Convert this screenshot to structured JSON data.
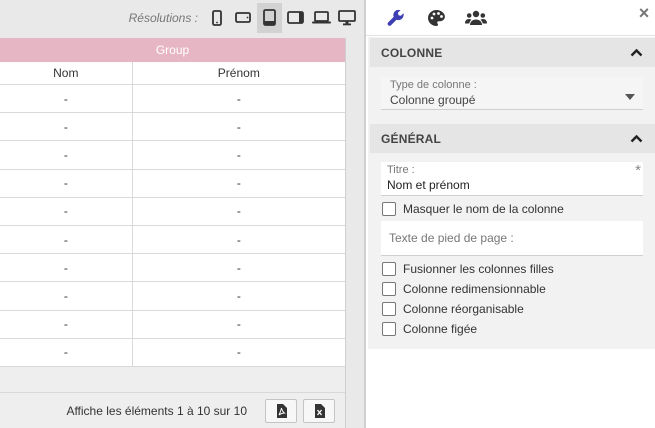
{
  "resolutions": {
    "label": "Résolutions :",
    "items": [
      {
        "name": "phone-portrait-icon",
        "active": false
      },
      {
        "name": "phone-landscape-icon",
        "active": false
      },
      {
        "name": "tablet-portrait-icon",
        "active": true
      },
      {
        "name": "tablet-landscape-icon",
        "active": false
      },
      {
        "name": "laptop-icon",
        "active": false
      },
      {
        "name": "desktop-icon",
        "active": false
      }
    ]
  },
  "grid": {
    "group_header": "Group",
    "columns": [
      "Nom",
      "Prénom"
    ],
    "rows": [
      [
        "-",
        "-"
      ],
      [
        "-",
        "-"
      ],
      [
        "-",
        "-"
      ],
      [
        "-",
        "-"
      ],
      [
        "-",
        "-"
      ],
      [
        "-",
        "-"
      ],
      [
        "-",
        "-"
      ],
      [
        "-",
        "-"
      ],
      [
        "-",
        "-"
      ],
      [
        "-",
        "-"
      ]
    ],
    "footer_text": "Affiche les éléments 1 à 10 sur 10",
    "export_buttons": [
      "pdf-export-icon",
      "excel-export-icon"
    ]
  },
  "panel": {
    "tabs": [
      "wrench-icon",
      "palette-icon",
      "users-icon"
    ],
    "active_tab": 0,
    "close_label": "×",
    "colonne_section": {
      "title": "COLONNE",
      "type_label": "Type de colonne :",
      "type_value": "Colonne groupé"
    },
    "general_section": {
      "title": "GÉNÉRAL",
      "titre_label": "Titre :",
      "titre_value": "Nom et prénom",
      "required_mark": "*",
      "hide_name_label": "Masquer le nom de la colonne",
      "footer_placeholder": "Texte de pied de page :",
      "checkboxes": [
        "Fusionner les colonnes filles",
        "Colonne redimensionnable",
        "Colonne réorganisable",
        "Colonne figée"
      ]
    }
  },
  "colors": {
    "accent": "#3f3fb5",
    "group_header_bg": "#e7b6c5"
  }
}
